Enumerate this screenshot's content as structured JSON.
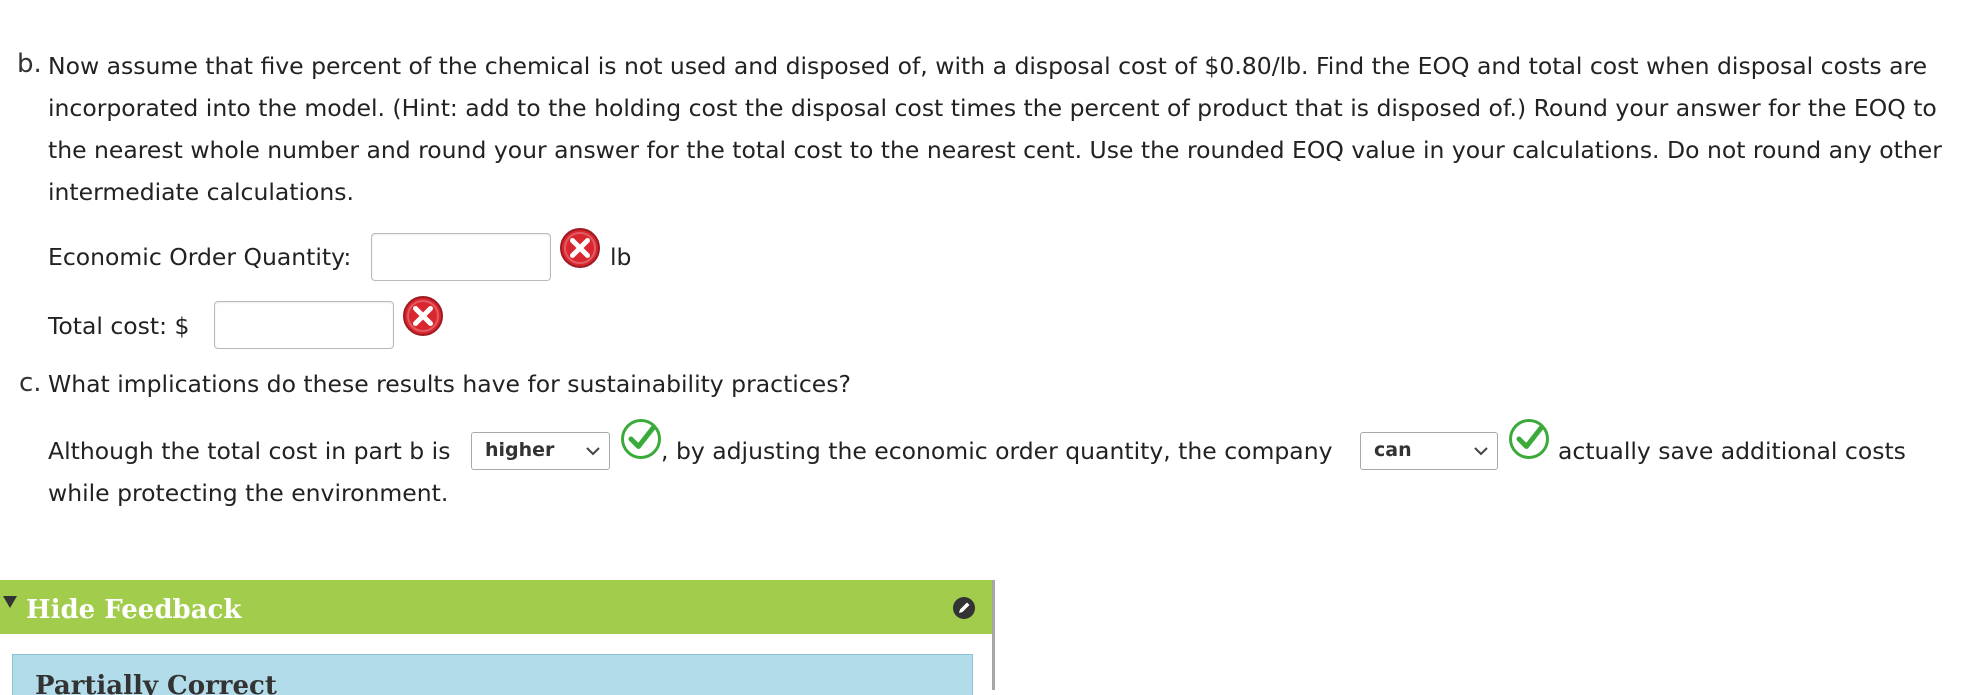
{
  "part_b": {
    "marker": "b.",
    "question": "Now assume that five percent of the chemical is not used and disposed of, with a disposal cost of $0.80/lb. Find the EOQ and total cost when disposal costs are incorporated into the model. (Hint: add to the holding cost the disposal cost times the percent of product that is disposed of.) Round your answer for the EOQ to the nearest whole number and round your answer for the total cost to the nearest cent. Use the rounded EOQ value in your calculations. Do not round any other intermediate calculations.",
    "eoq_label": "Economic Order Quantity:",
    "eoq_value": "",
    "eoq_unit": "lb",
    "eoq_status": "incorrect",
    "total_cost_label": "Total cost: $",
    "total_cost_value": "",
    "total_cost_status": "incorrect"
  },
  "part_c": {
    "marker": "c.",
    "question": "What implications do these results have for sustainability practices?",
    "sentence_part1": "Although the total cost in part b is",
    "select1_value": "higher",
    "select1_status": "correct",
    "sentence_part2": ", by adjusting the economic order quantity, the company",
    "select2_value": "can",
    "select2_status": "correct",
    "sentence_part3": "actually save additional costs",
    "sentence_part4": "while protecting the environment."
  },
  "feedback": {
    "toggle_label": "Hide Feedback",
    "result_title": "Partially Correct"
  },
  "icons": {
    "incorrect": "x-circle-icon",
    "correct": "check-circle-icon",
    "collapse": "triangle-down-icon",
    "edit": "pencil-icon"
  },
  "colors": {
    "incorrect": "#d9262f",
    "correct": "#3aab3a",
    "feedback_header": "#a1cc4c",
    "feedback_body": "#b2dcea"
  }
}
